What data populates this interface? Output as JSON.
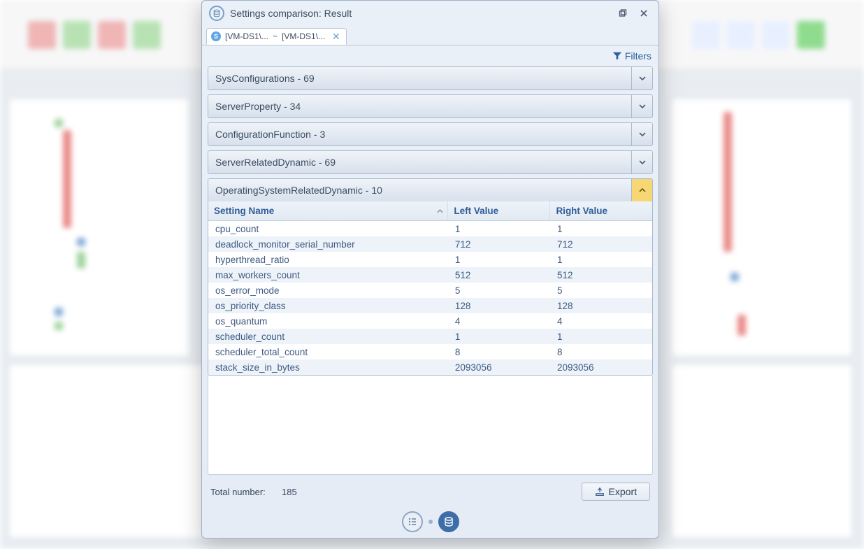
{
  "window": {
    "title": "Settings comparison: Result"
  },
  "tab": {
    "left": "[VM-DS1\\...",
    "sep": "~",
    "right": "[VM-DS1\\..."
  },
  "filters_label": "Filters",
  "groups": [
    {
      "name": "SysConfigurations",
      "count": 69,
      "expanded": false
    },
    {
      "name": "ServerProperty",
      "count": 34,
      "expanded": false
    },
    {
      "name": "ConfigurationFunction",
      "count": 3,
      "expanded": false
    },
    {
      "name": "ServerRelatedDynamic",
      "count": 69,
      "expanded": false
    },
    {
      "name": "OperatingSystemRelatedDynamic",
      "count": 10,
      "expanded": true
    }
  ],
  "columns": {
    "c0": "Setting Name",
    "c1": "Left Value",
    "c2": "Right Value"
  },
  "rows": [
    {
      "name": "cpu_count",
      "left": "1",
      "right": "1"
    },
    {
      "name": "deadlock_monitor_serial_number",
      "left": "712",
      "right": "712"
    },
    {
      "name": "hyperthread_ratio",
      "left": "1",
      "right": "1"
    },
    {
      "name": "max_workers_count",
      "left": "512",
      "right": "512"
    },
    {
      "name": "os_error_mode",
      "left": "5",
      "right": "5"
    },
    {
      "name": "os_priority_class",
      "left": "128",
      "right": "128"
    },
    {
      "name": "os_quantum",
      "left": "4",
      "right": "4"
    },
    {
      "name": "scheduler_count",
      "left": "1",
      "right": "1"
    },
    {
      "name": "scheduler_total_count",
      "left": "8",
      "right": "8"
    },
    {
      "name": "stack_size_in_bytes",
      "left": "2093056",
      "right": "2093056"
    }
  ],
  "total": {
    "label": "Total number:",
    "value": 185
  },
  "export_label": "Export"
}
